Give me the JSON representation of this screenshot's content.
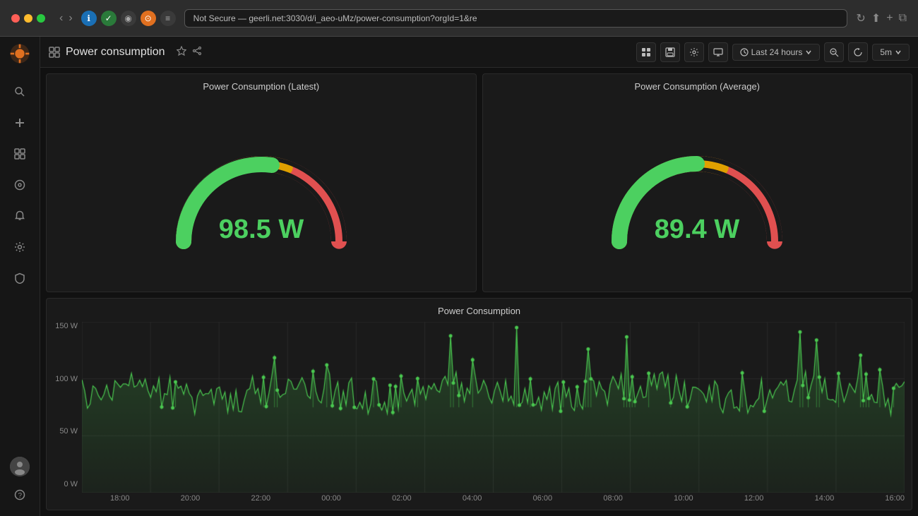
{
  "browser": {
    "address": "Not Secure — geerli.net:3030/d/i_aeo-uMz/power-consumption?orgId=1&re"
  },
  "topbar": {
    "title": "Power consumption",
    "time_range": "Last 24 hours",
    "refresh_rate": "5m"
  },
  "panels": {
    "gauge_latest": {
      "title": "Power Consumption (Latest)",
      "value": "98.5 W"
    },
    "gauge_average": {
      "title": "Power Consumption (Average)",
      "value": "89.4 W"
    },
    "chart": {
      "title": "Power Consumption",
      "y_labels": [
        "150 W",
        "100 W",
        "50 W",
        "0 W"
      ],
      "x_labels": [
        "18:00",
        "20:00",
        "22:00",
        "00:00",
        "02:00",
        "04:00",
        "06:00",
        "08:00",
        "10:00",
        "12:00",
        "14:00",
        "16:00"
      ]
    }
  },
  "sidebar": {
    "items": [
      {
        "label": "Search",
        "icon": "🔍"
      },
      {
        "label": "Add",
        "icon": "+"
      },
      {
        "label": "Dashboards",
        "icon": "⊞"
      },
      {
        "label": "Explore",
        "icon": "◎"
      },
      {
        "label": "Alerts",
        "icon": "🔔"
      },
      {
        "label": "Settings",
        "icon": "⚙"
      },
      {
        "label": "Shield",
        "icon": "🛡"
      }
    ]
  }
}
